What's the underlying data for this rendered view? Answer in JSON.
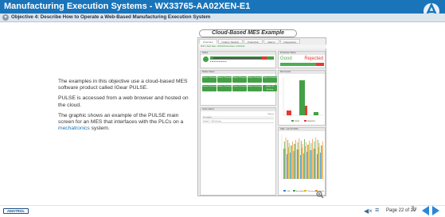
{
  "header": {
    "title": "Manufacturing Execution Systems - WX33765-AA02XEN-E1",
    "objective": "Objective 4: Describe How to Operate a Web-Based Manufacturing Execution System"
  },
  "content": {
    "paragraphs": [
      "The examples in this objective use a cloud-based MES software product called IGear PULSE.",
      "PULSE is accessed from a web browser and hosted on the cloud."
    ],
    "para3_before": "The graphic shows an example of the PULSE main screen for an MES that interfaces with the PLCs on a ",
    "para3_link": "mechatronics",
    "para3_after": " system."
  },
  "example": {
    "title": "Cloud-Based MES Example",
    "tabs": [
      "Overview",
      "Orders / Models",
      "Production",
      "Alarms",
      "Diagnostics"
    ],
    "time_line": "Shift 1   Start Date: 12/5/2019   End Date: 12/5/2019",
    "panels": {
      "status": "Status",
      "production_status": "Production Status",
      "station_status": "Station Status",
      "part_counts": "Part Counts",
      "active_alarms": "Active Alarms",
      "oee": "OEE - Last 30 Shifts"
    },
    "good_label": "Good",
    "rejected_label": "Rejected",
    "good_count": "1 / 2",
    "rejected_count": "2",
    "stations": [
      "Station 1 Running",
      "Station 2 Running",
      "Station 3 Running",
      "Station 4 Running",
      "Station 5 Running",
      "Station 6 Running",
      "Station 7 Running",
      "Station 8 Running",
      "Station 9 Running",
      "Station 10 Running"
    ],
    "alarm_column": "Description",
    "alarm_row": "Station 1 - Self-clearing",
    "refresh": "Refresh",
    "part_legend": [
      "Good",
      "Rejected"
    ],
    "oee_legend": [
      "OEE",
      "Availability",
      "Performance",
      "Quality"
    ]
  },
  "footer": {
    "brand": "AMATROL",
    "page_text": "Page 22 of 29"
  },
  "colors": {
    "titlebar": "#1a74b9",
    "good": "#4caf50",
    "rejected": "#e53935",
    "nav_arrow": "#2b86d6"
  },
  "icons": [
    "amatrol-logo-icon",
    "chevron-down-icon",
    "audio-icon",
    "menu-icon",
    "reload-icon",
    "prev-arrow-icon",
    "next-arrow-icon",
    "zoom-icon"
  ]
}
